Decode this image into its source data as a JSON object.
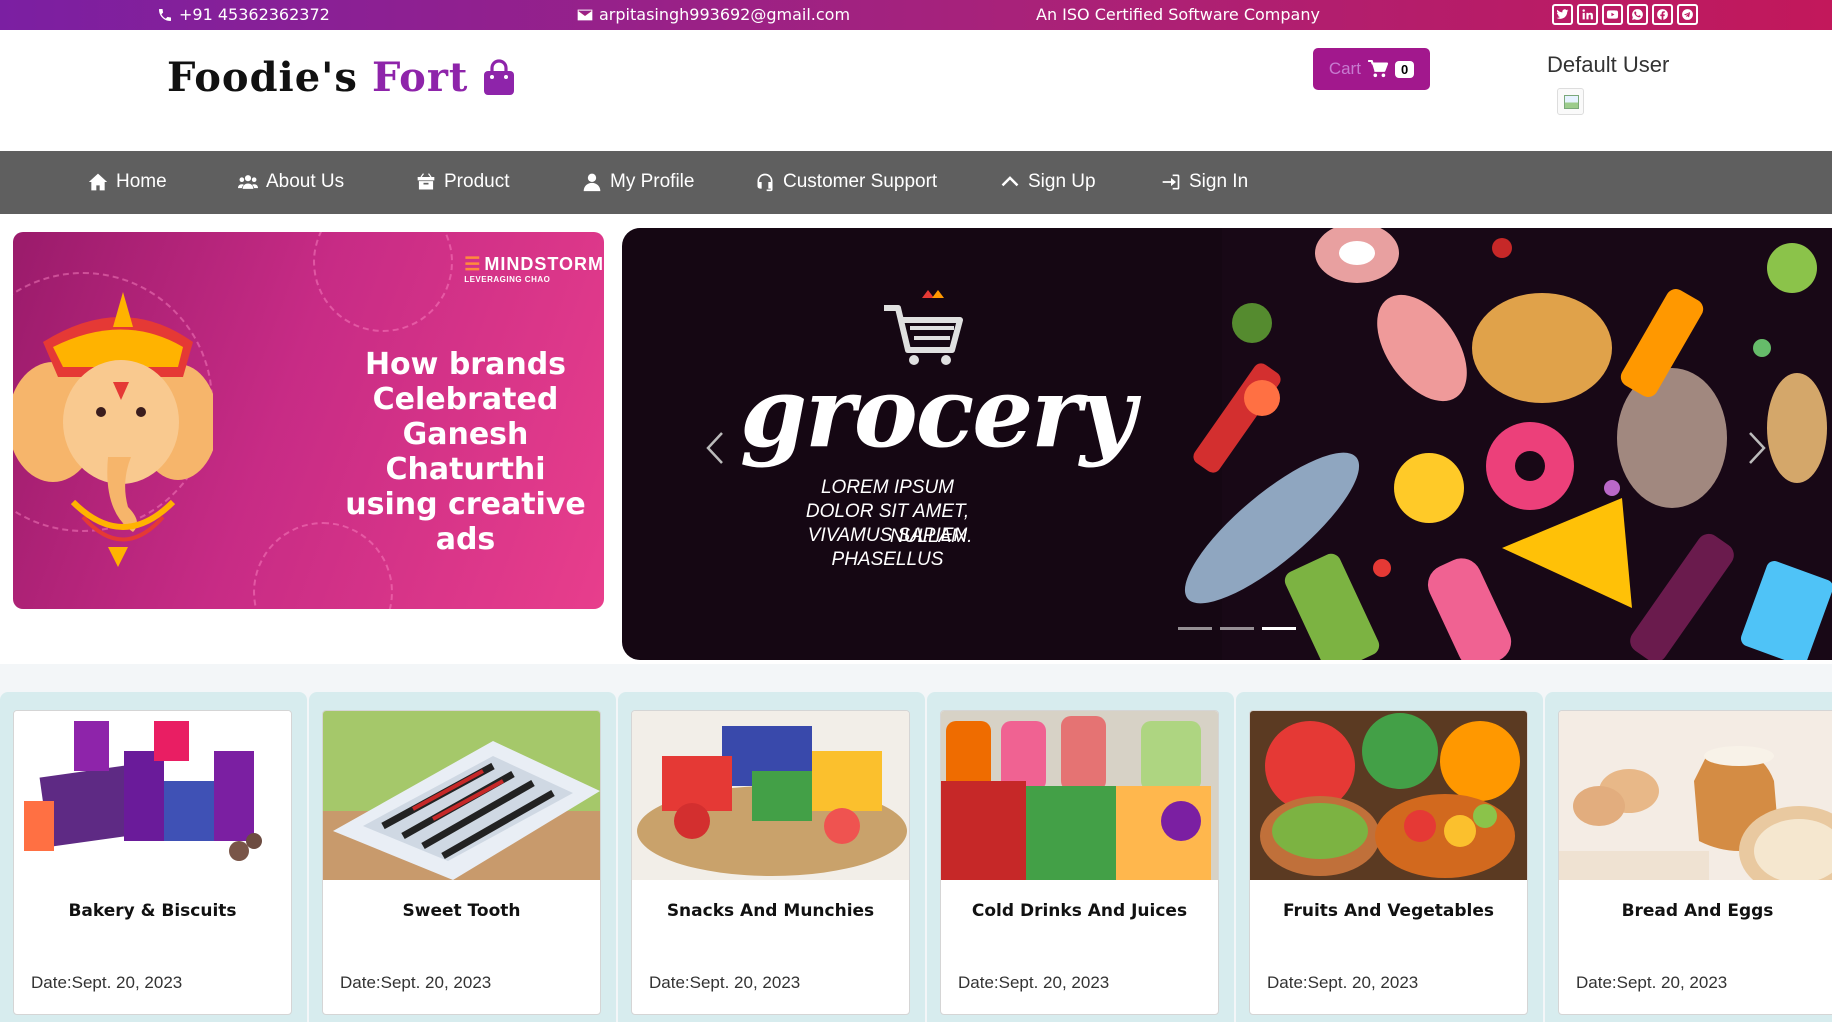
{
  "topbar": {
    "phone": "+91 45362362372",
    "email": "arpitasingh993692@gmail.com",
    "tagline": "An ISO Certified Software Company",
    "social_icons": [
      "twitter-icon",
      "linkedin-icon",
      "youtube-icon",
      "whatsapp-icon",
      "facebook-icon",
      "telegram-icon"
    ]
  },
  "header": {
    "logo_part1": "Foodie's",
    "logo_part2": "Fort",
    "cart_label": "Cart",
    "cart_count": "0",
    "user_name": "Default User"
  },
  "nav": {
    "items": [
      {
        "label": "Home",
        "icon": "home-icon"
      },
      {
        "label": "About Us",
        "icon": "users-icon"
      },
      {
        "label": "Product",
        "icon": "box-icon"
      },
      {
        "label": "My Profile",
        "icon": "user-icon"
      },
      {
        "label": "Customer Support",
        "icon": "headset-icon"
      },
      {
        "label": "Sign Up",
        "icon": "chevron-up-icon"
      },
      {
        "label": "Sign In",
        "icon": "sign-in-icon"
      }
    ]
  },
  "banner_left": {
    "brand": "MINDSTORM",
    "brand_sub": "LEVERAGING CHAO",
    "title_lines": [
      "How brands",
      "Celebrated",
      "Ganesh Chaturthi",
      "using creative ads"
    ]
  },
  "carousel": {
    "title": "grocery",
    "subtitle_line1": "LOREM IPSUM DOLOR SIT AMET,",
    "subtitle_line2": "VIVAMUS SAPIEN PHASELLUS",
    "subtitle_line3": "NULLAM.",
    "slide_count": 3,
    "active_slide": 3
  },
  "categories": [
    {
      "name": "Bakery & Biscuits",
      "date": "Date:Sept. 20, 2023"
    },
    {
      "name": "Sweet Tooth",
      "date": "Date:Sept. 20, 2023"
    },
    {
      "name": "Snacks And Munchies",
      "date": "Date:Sept. 20, 2023"
    },
    {
      "name": "Cold Drinks And Juices",
      "date": "Date:Sept. 20, 2023"
    },
    {
      "name": "Fruits And Vegetables",
      "date": "Date:Sept. 20, 2023"
    },
    {
      "name": "Bread And Eggs",
      "date": "Date:Sept. 20, 2023"
    }
  ],
  "colors": {
    "topbar_start": "#7b1fa2",
    "topbar_end": "#c2185b",
    "brand_purple": "#8e24aa",
    "cart_bg": "#a2188d",
    "nav_bg": "#5f5f5f",
    "category_bg": "#d7ecee"
  }
}
